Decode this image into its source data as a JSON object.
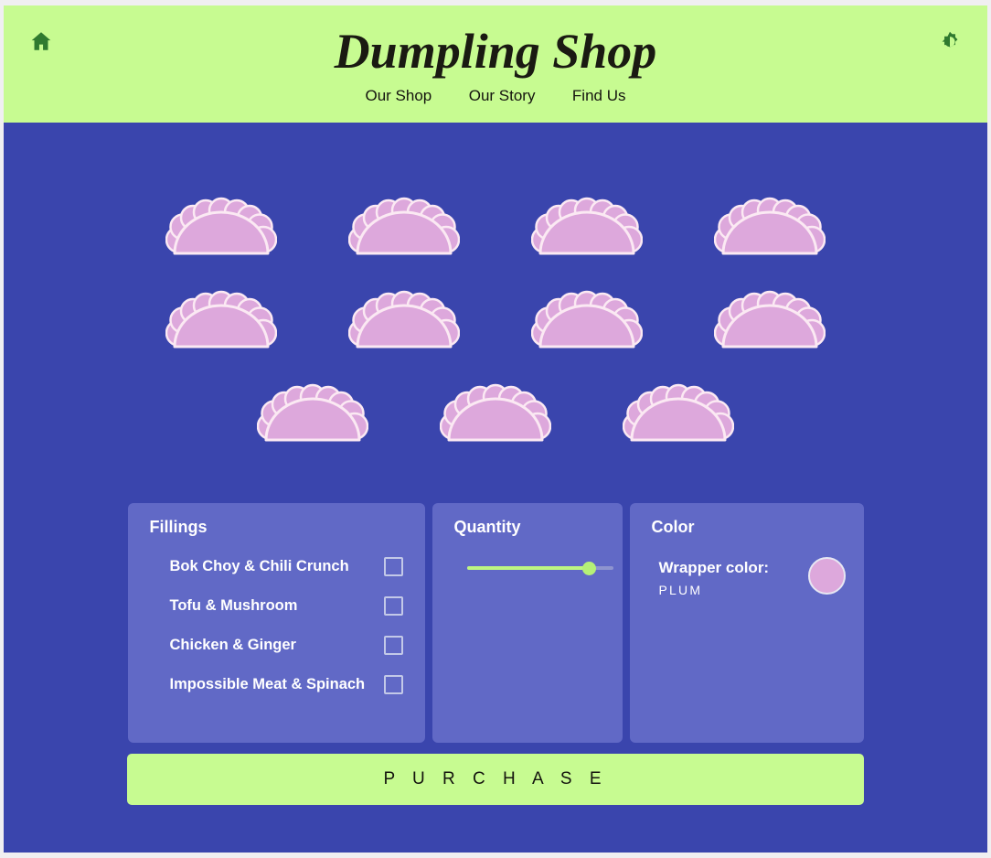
{
  "header": {
    "title": "Dumpling Shop",
    "home_icon": "home-icon",
    "theme_icon": "brightness-toggle-icon",
    "nav": [
      {
        "label": "Our Shop"
      },
      {
        "label": "Our Story"
      },
      {
        "label": "Find Us"
      }
    ]
  },
  "colors": {
    "header_background": "#c7fb91",
    "page_background": "#3a45ad",
    "panel_background": "#6169c6",
    "dumpling_fill": "#dda8dc",
    "dumpling_outline": "#fbe9f3",
    "accent_green": "#bdf582",
    "text_dark": "#14140e",
    "text_light": "#ffffff"
  },
  "preview": {
    "dumpling_count": 11,
    "rows": [
      4,
      4,
      3
    ],
    "dumpling_name": "dumpling"
  },
  "panels": {
    "fillings": {
      "title": "Fillings",
      "items": [
        {
          "label": "Bok Choy & Chili Crunch",
          "checked": false
        },
        {
          "label": "Tofu & Mushroom",
          "checked": false
        },
        {
          "label": "Chicken & Ginger",
          "checked": false
        },
        {
          "label": "Impossible Meat & Spinach",
          "checked": false
        }
      ]
    },
    "quantity": {
      "title": "Quantity",
      "slider": {
        "value_percent": 84,
        "min": 0,
        "max": 100
      }
    },
    "color": {
      "title": "Color",
      "wrapper_label": "Wrapper color:",
      "wrapper_value": "PLUM",
      "swatch_color": "#dda8dc"
    }
  },
  "purchase": {
    "label": "P U R C H A S E"
  }
}
